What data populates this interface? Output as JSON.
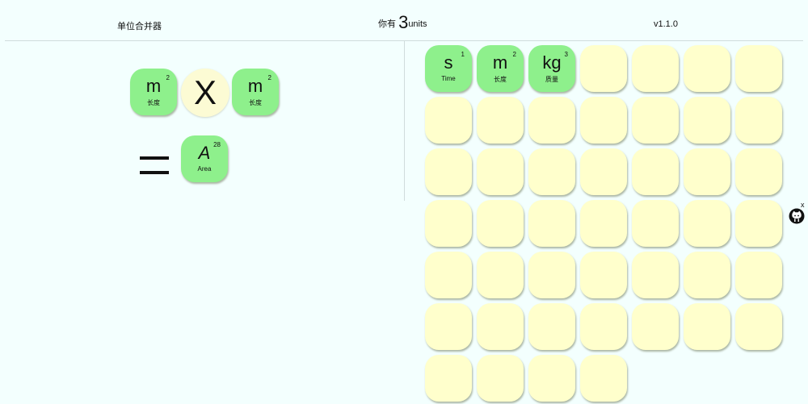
{
  "header": {
    "title": "单位合并器",
    "count_prefix": "你有",
    "count_value": "3",
    "count_suffix": "units",
    "version": "v1.1.0"
  },
  "combiner": {
    "operand_a": {
      "symbol": "m",
      "exponent": "2",
      "label": "长度"
    },
    "operator": "X",
    "operand_b": {
      "symbol": "m",
      "exponent": "2",
      "label": "长度"
    },
    "result": {
      "symbol": "A",
      "exponent": "28",
      "label": "Area"
    }
  },
  "inventory": {
    "units": [
      {
        "symbol": "s",
        "exponent": "1",
        "label": "Time"
      },
      {
        "symbol": "m",
        "exponent": "2",
        "label": "长度"
      },
      {
        "symbol": "kg",
        "exponent": "3",
        "label": "质量"
      }
    ],
    "rows_full": 6,
    "columns": 7,
    "last_row_slots": 4
  },
  "corner": {
    "close_label": "x",
    "icon": "github-octocat-icon"
  },
  "colors": {
    "background": "#f3fffe",
    "unit_tile": "#8ef08c",
    "empty_slot": "#ffffcc",
    "operator_circle": "#fcfbd4"
  }
}
